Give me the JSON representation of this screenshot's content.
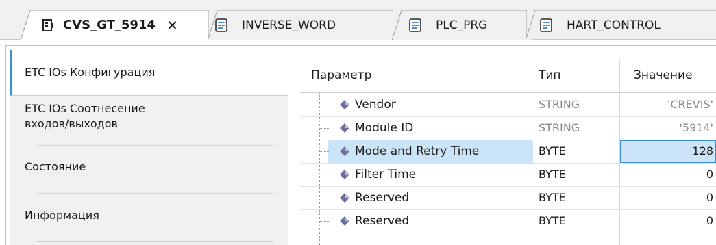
{
  "tabs": [
    {
      "label": "CVS_GT_5914",
      "active": true,
      "icon": "device-icon",
      "closable": true
    },
    {
      "label": "INVERSE_WORD",
      "active": false,
      "icon": "document-icon"
    },
    {
      "label": "PLC_PRG",
      "active": false,
      "icon": "document-icon"
    },
    {
      "label": "HART_CONTROL",
      "active": false,
      "icon": "document-icon"
    }
  ],
  "close_glyph": "✕",
  "sidebar": {
    "items": [
      {
        "label": "ETC IOs Конфигурация",
        "selected": true
      },
      {
        "label": "ETC IOs Соотнесение входов/выходов",
        "line1": "ETC IOs Соотнесение",
        "line2": "входов/выходов"
      },
      {
        "label": "Состояние"
      },
      {
        "label": "Информация"
      }
    ]
  },
  "grid": {
    "columns": {
      "param": "Параметр",
      "type": "Тип",
      "value": "Значение"
    },
    "rows": [
      {
        "name": "Vendor",
        "type": "STRING",
        "value": "'CREVIS'",
        "readonly": true
      },
      {
        "name": "Module ID",
        "type": "STRING",
        "value": "'5914'",
        "readonly": true
      },
      {
        "name": "Mode and Retry Time",
        "type": "BYTE",
        "value": "128",
        "selected": true
      },
      {
        "name": "Filter Time",
        "type": "BYTE",
        "value": "0"
      },
      {
        "name": "Reserved",
        "type": "BYTE",
        "value": "0"
      },
      {
        "name": "Reserved",
        "type": "BYTE",
        "value": "0"
      }
    ]
  },
  "colors": {
    "selection": "#cce4f7",
    "accent": "#3c8fd6",
    "readonly_text": "#8a8a8a"
  }
}
